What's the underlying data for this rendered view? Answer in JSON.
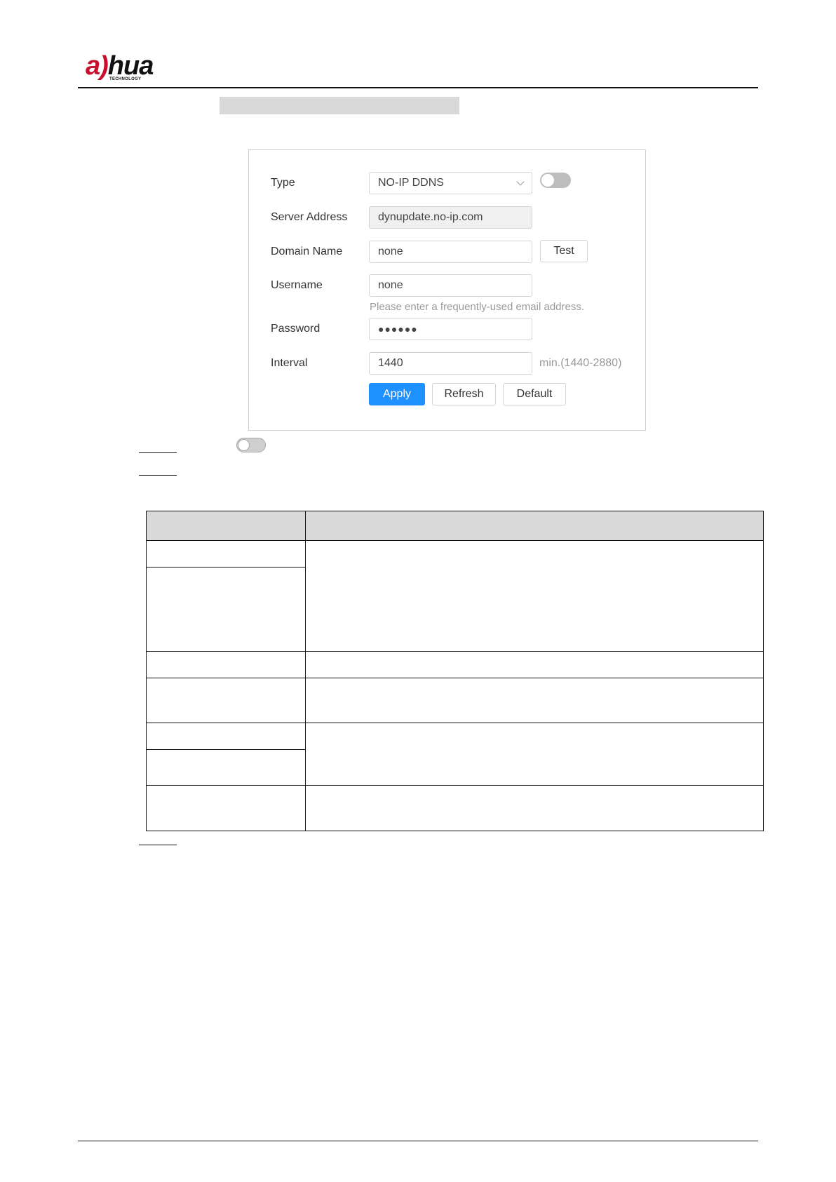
{
  "brand": {
    "logo_text": "a)hua",
    "logo_subtext": "TECHNOLOGY"
  },
  "ddns_form": {
    "type": {
      "label": "Type",
      "value": "NO-IP DDNS",
      "enabled": false
    },
    "server_address": {
      "label": "Server Address",
      "value": "dynupdate.no-ip.com"
    },
    "domain_name": {
      "label": "Domain Name",
      "value": "none",
      "test_label": "Test"
    },
    "username": {
      "label": "Username",
      "value": "none",
      "hint": "Please enter a frequently-used email address."
    },
    "password": {
      "label": "Password",
      "value": "●●●●●●"
    },
    "interval": {
      "label": "Interval",
      "value": "1440",
      "unit": "min.(1440-2880)"
    },
    "buttons": {
      "apply": "Apply",
      "refresh": "Refresh",
      "default": "Default"
    }
  },
  "colors": {
    "accent": "#1e90ff",
    "toggle_off": "#bdbdbd",
    "header_fill": "#d9d9d9"
  }
}
